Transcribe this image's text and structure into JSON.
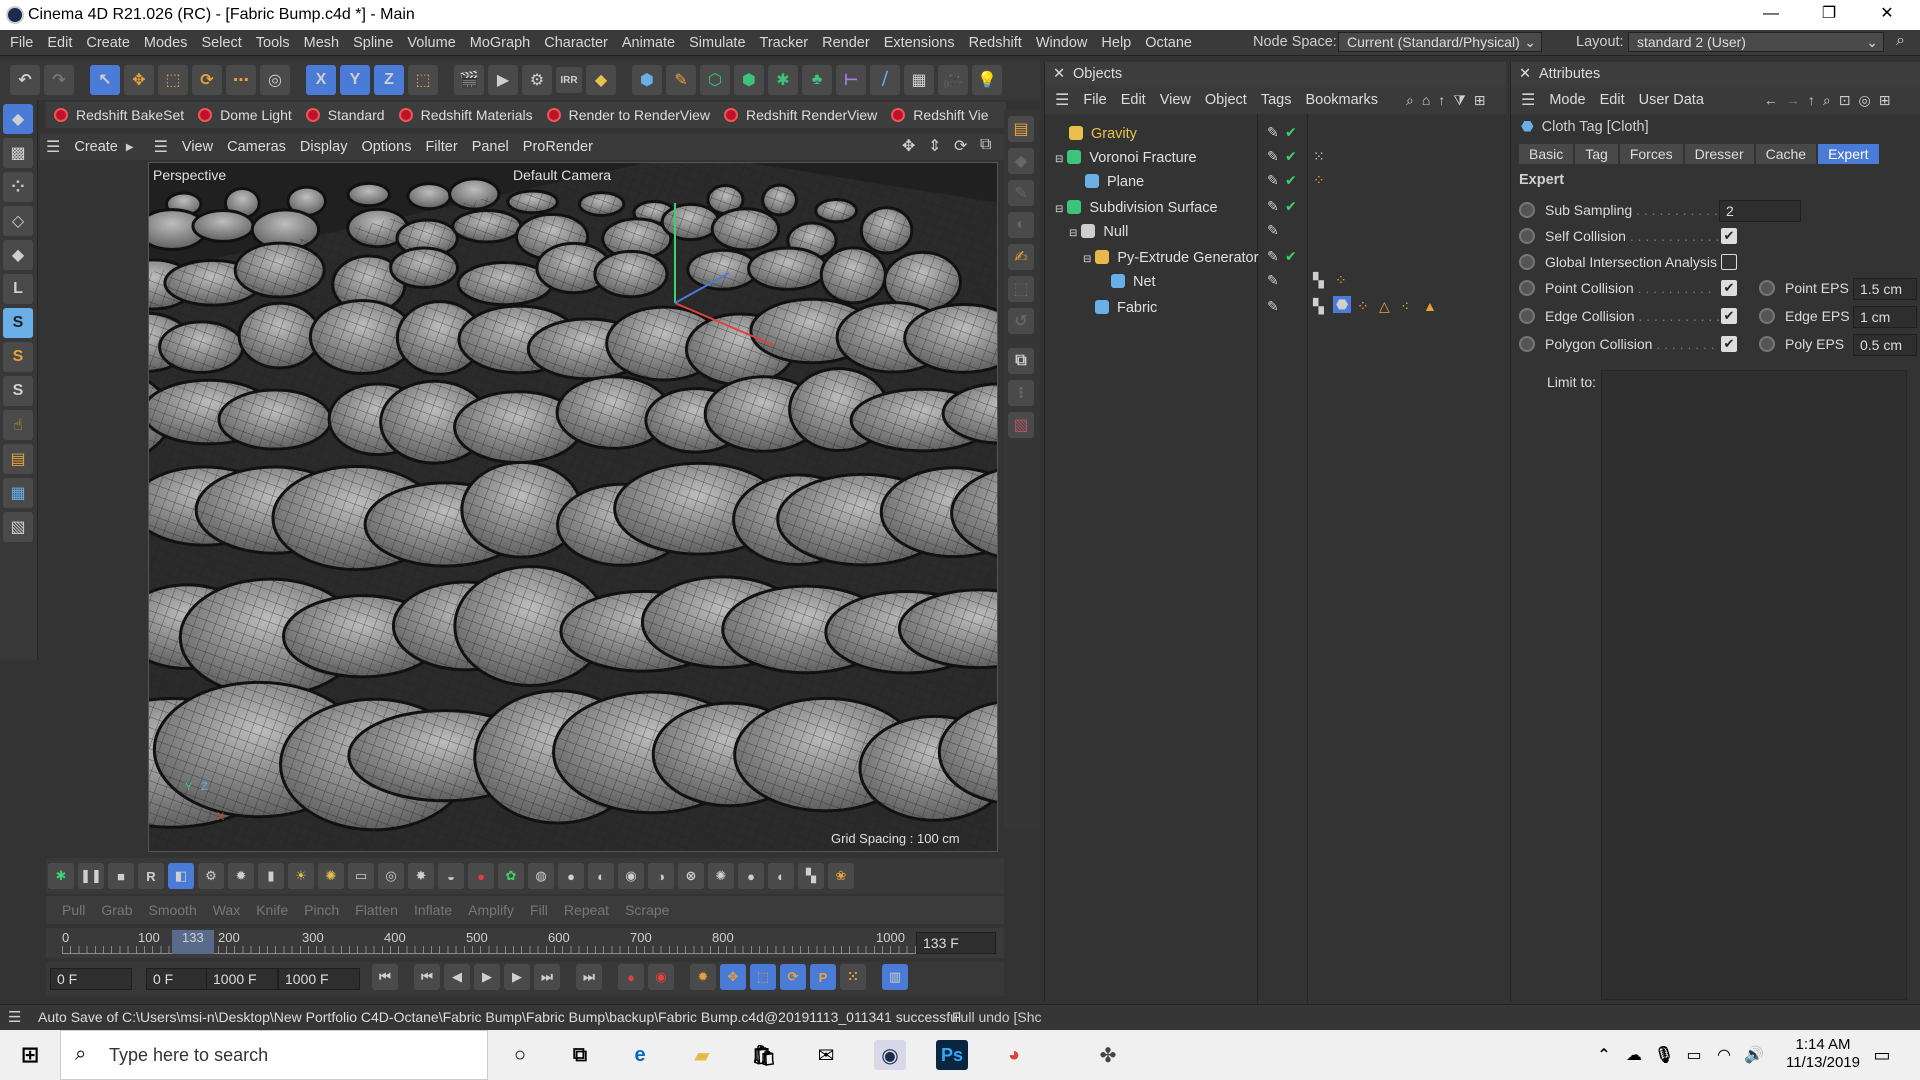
{
  "window": {
    "title": "Cinema 4D R21.026 (RC) - [Fabric Bump.c4d *] - Main",
    "minimize": "—",
    "restore": "❐",
    "close": "✕"
  },
  "menubar": {
    "items": [
      "File",
      "Edit",
      "Create",
      "Modes",
      "Select",
      "Tools",
      "Mesh",
      "Spline",
      "Volume",
      "MoGraph",
      "Character",
      "Animate",
      "Simulate",
      "Tracker",
      "Render",
      "Extensions",
      "Redshift",
      "Window",
      "Help",
      "Octane"
    ],
    "node_space_label": "Node Space:",
    "node_space_value": "Current (Standard/Physical)",
    "layout_label": "Layout:",
    "layout_value": "standard 2 (User)"
  },
  "maintoolbar": {
    "axis_x": "X",
    "axis_y": "Y",
    "axis_z": "Z",
    "irr": "IRR"
  },
  "shelf": {
    "items": [
      "Redshift BakeSet",
      "Dome Light",
      "Standard",
      "Redshift Materials",
      "Render to RenderView",
      "Redshift RenderView",
      "Redshift Vie"
    ]
  },
  "viewport_menu": {
    "create": "Create",
    "items": [
      "View",
      "Cameras",
      "Display",
      "Options",
      "Filter",
      "Panel",
      "ProRender"
    ]
  },
  "viewport": {
    "perspective_label": "Perspective",
    "camera_label": "Default Camera",
    "grid_spacing": "Grid Spacing : 100 cm",
    "axis_y": "Y",
    "axis_z": "Z",
    "axis_x": "X"
  },
  "sculpt": {
    "items": [
      "Pull",
      "Grab",
      "Smooth",
      "Wax",
      "Knife",
      "Pinch",
      "Flatten",
      "Inflate",
      "Amplify",
      "Fill",
      "Repeat",
      "Scrape"
    ]
  },
  "timeline": {
    "ticks": [
      "0",
      "100",
      "133",
      "200",
      "300",
      "400",
      "500",
      "600",
      "700",
      "800",
      "900",
      "1000"
    ],
    "current_frame": "133 F"
  },
  "transport": {
    "start": "0 F",
    "range_start": "0 F",
    "range_end": "1000 F",
    "end": "1000 F"
  },
  "status": {
    "text": "Auto Save of C:\\Users\\msi-n\\Desktop\\New Portfolio C4D-Octane\\Fabric Bump\\Fabric Bump\\backup\\Fabric Bump.c4d@20191113_011341 successful",
    "undo": "Full undo [Shc"
  },
  "objects": {
    "title": "Objects",
    "menu": [
      "File",
      "Edit",
      "View",
      "Object",
      "Tags",
      "Bookmarks"
    ],
    "tree": [
      {
        "name": "Gravity",
        "color": "#e8c24a",
        "icon": "gravity-icon"
      },
      {
        "name": "Voronoi Fracture",
        "color": "#3bc47a",
        "icon": "voronoi-icon"
      },
      {
        "name": "Plane",
        "color": "#6aaee8",
        "icon": "plane-icon"
      },
      {
        "name": "Subdivision Surface",
        "color": "#3bc47a",
        "icon": "subdivision-icon"
      },
      {
        "name": "Null",
        "color": "#cfcfcf",
        "icon": "null-icon"
      },
      {
        "name": "Py-Extrude Generator",
        "color": "#e8b84a",
        "icon": "generator-icon"
      },
      {
        "name": "Net",
        "color": "#6aaee8",
        "icon": "mesh-icon"
      },
      {
        "name": "Fabric",
        "color": "#6aaee8",
        "icon": "mesh-icon"
      }
    ]
  },
  "attributes": {
    "title": "Attributes",
    "menu": [
      "Mode",
      "Edit",
      "User Data"
    ],
    "object_label": "Cloth Tag [Cloth]",
    "tabs": [
      "Basic",
      "Tag",
      "Forces",
      "Dresser",
      "Cache",
      "Expert"
    ],
    "active_tab": "Expert",
    "section": "Expert",
    "sub_sampling_label": "Sub Sampling",
    "sub_sampling_value": "2",
    "self_collision_label": "Self Collision",
    "self_collision": true,
    "global_intersection_label": "Global Intersection Analysis",
    "global_intersection": false,
    "point_collision_label": "Point Collision",
    "point_collision": true,
    "point_eps_label": "Point EPS",
    "point_eps_value": "1.5 cm",
    "edge_collision_label": "Edge Collision",
    "edge_collision": true,
    "edge_eps_label": "Edge EPS",
    "edge_eps_value": "1 cm",
    "polygon_collision_label": "Polygon Collision",
    "polygon_collision": true,
    "poly_eps_label": "Poly EPS",
    "poly_eps_value": "0.5 cm",
    "limit_to_label": "Limit to:"
  },
  "taskbar": {
    "search_placeholder": "Type here to search",
    "time": "1:14 AM",
    "date": "11/13/2019",
    "ps_label": "Ps"
  },
  "colors": {
    "accent": "#4a7bd6",
    "checkmark": "#3bd36b",
    "shelf_red": "#c0102a"
  }
}
